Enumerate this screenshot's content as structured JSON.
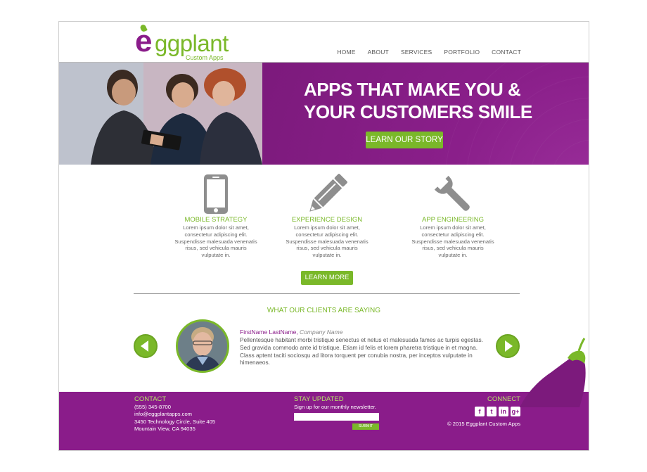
{
  "logo": {
    "e": "e",
    "word": "ggplant",
    "sub": "Custom Apps"
  },
  "nav": [
    "HOME",
    "ABOUT",
    "SERVICES",
    "PORTFOLIO",
    "CONTACT"
  ],
  "hero": {
    "title": "APPS THAT MAKE YOU & YOUR CUSTOMERS SMILE",
    "cta": "LEARN OUR STORY"
  },
  "features": [
    {
      "icon": "smartphone-icon",
      "title": "MOBILE STRATEGY",
      "text": "Lorem ipsum dolor sit amet, consectetur adipiscing elit. Suspendisse malesuada venenatis risus, sed vehicula mauris vulputate in."
    },
    {
      "icon": "pencil-icon",
      "title": "EXPERIENCE DESIGN",
      "text": "Lorem ipsum dolor sit amet, consectetur adipiscing elit. Suspendisse malesuada venenatis risus, sed vehicula mauris vulputate in."
    },
    {
      "icon": "wrench-icon",
      "title": "APP ENGINEERING",
      "text": "Lorem ipsum dolor sit amet, consectetur adipiscing elit. Suspendisse malesuada venenatis risus, sed vehicula mauris vulputate in."
    }
  ],
  "learn_more": "LEARN MORE",
  "testimonials": {
    "heading": "WHAT OUR CLIENTS ARE SAYING",
    "name": "FirstName LastName",
    "company": "Company Name",
    "body": "Pellentesque habitant morbi tristique senectus et netus et malesuada fames ac turpis egestas. Sed gravida commodo ante id tristique. Etiam id felis et lorem pharetra tristique in et magna. Class aptent taciti sociosqu ad litora torquent per conubia nostra, per inceptos vulputate in himenaeos."
  },
  "footer": {
    "contact_heading": "CONTACT",
    "phone": "(555) 345-8700",
    "email": "info@eggplantapps.com",
    "address1": "3450 Technology Circle, Suite 405",
    "address2": "Mountain View, CA 94035",
    "stay_heading": "STAY UPDATED",
    "stay_text": "Sign up for our monthly newsletter.",
    "submit": "SUBMIT",
    "connect_heading": "CONNECT",
    "social": [
      "f",
      "t",
      "in",
      "g+"
    ],
    "copyright": "© 2015 Eggplant Custom Apps"
  },
  "colors": {
    "purple": "#8a1c8a",
    "green": "#7ab829"
  }
}
